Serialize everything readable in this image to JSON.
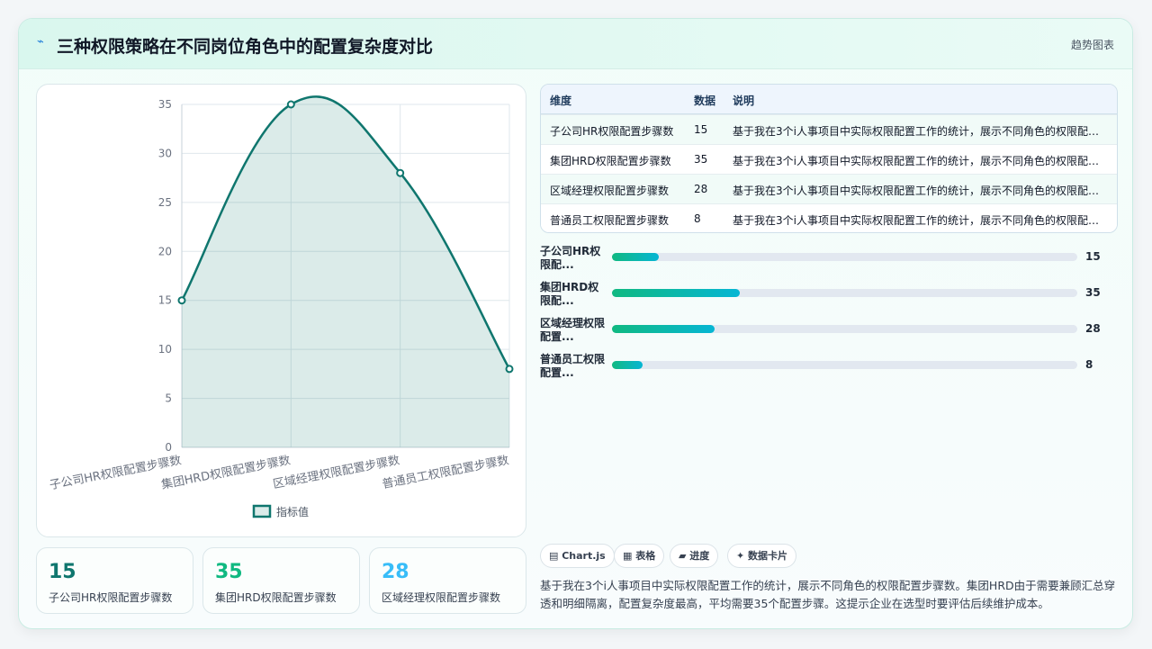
{
  "header": {
    "title": "三种权限策略在不同岗位角色中的配置复杂度对比",
    "tag": "趋势图表",
    "logo_icon": "bolt-icon"
  },
  "chart_data": {
    "type": "area",
    "categories": [
      "子公司HR权限配置步骤数",
      "集团HRD权限配置步骤数",
      "区域经理权限配置步骤数",
      "普通员工权限配置步骤数"
    ],
    "series": [
      {
        "name": "指标值",
        "values": [
          15,
          35,
          28,
          8
        ]
      }
    ],
    "ylim": [
      0,
      35
    ],
    "yticks": [
      0,
      5,
      10,
      15,
      20,
      25,
      30,
      35
    ],
    "grid": true,
    "legend": "bottom",
    "color": "#0f766e"
  },
  "stats": [
    {
      "value": "15",
      "label": "子公司HR权限配置步骤数",
      "color": "#0f766e"
    },
    {
      "value": "35",
      "label": "集团HRD权限配置步骤数",
      "color": "#10b981"
    },
    {
      "value": "28",
      "label": "区域经理权限配置步骤数",
      "color": "#38bdf8"
    }
  ],
  "table": {
    "headers": [
      "维度",
      "数据",
      "说明"
    ],
    "rows": [
      [
        "子公司HR权限配置步骤数",
        "15",
        "基于我在3个i人事项目中实际权限配置工作的统计，展示不同角色的权限配置步骤数。"
      ],
      [
        "集团HRD权限配置步骤数",
        "35",
        "基于我在3个i人事项目中实际权限配置工作的统计，展示不同角色的权限配置步骤数。"
      ],
      [
        "区域经理权限配置步骤数",
        "28",
        "基于我在3个i人事项目中实际权限配置工作的统计，展示不同角色的权限配置步骤数。"
      ],
      [
        "普通员工权限配置步骤数",
        "8",
        "基于我在3个i人事项目中实际权限配置工作的统计，展示不同角色的权限配置步骤数。"
      ]
    ]
  },
  "bars": [
    {
      "label": "子公司HR权限配...",
      "value": "15",
      "fraction": 0.1
    },
    {
      "label": "集团HRD权限配...",
      "value": "35",
      "fraction": 0.275
    },
    {
      "label": "区域经理权限配置...",
      "value": "28",
      "fraction": 0.22
    },
    {
      "label": "普通员工权限配置...",
      "value": "8",
      "fraction": 0.065
    }
  ],
  "chips": [
    "▤ Chart.js",
    "▦ 表格",
    "▰ 进度",
    "✦ 数据卡片"
  ],
  "description": "基于我在3个i人事项目中实际权限配置工作的统计，展示不同角色的权限配置步骤数。集团HRD由于需要兼顾汇总穿透和明细隔离，配置复杂度最高，平均需要35个配置步骤。这提示企业在选型时要评估后续维护成本。"
}
